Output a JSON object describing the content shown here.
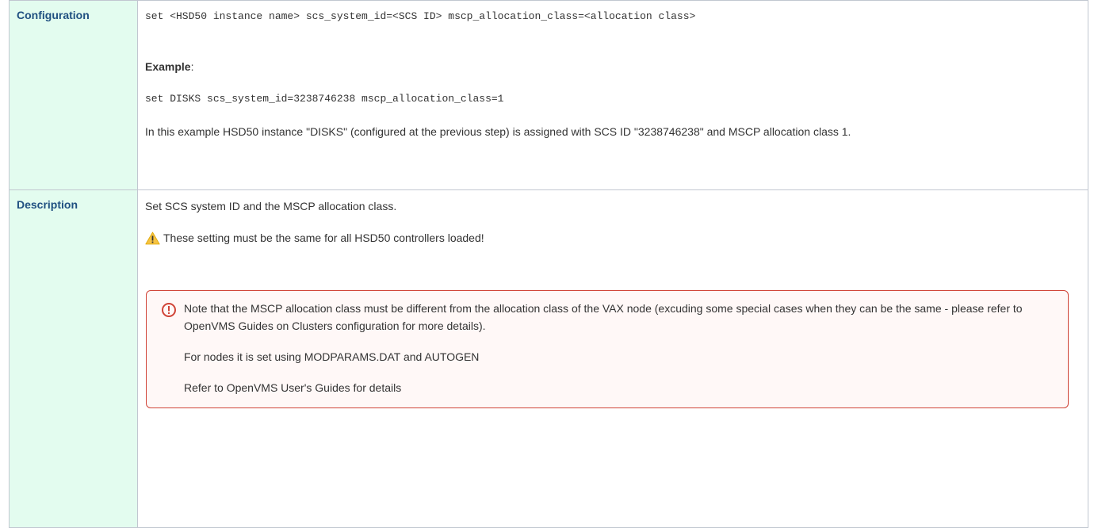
{
  "rows": {
    "configuration": {
      "label": "Configuration",
      "syntax": "set <HSD50 instance name> scs_system_id=<SCS ID> mscp_allocation_class=<allocation class>",
      "example_label": "Example",
      "example_colon": ":",
      "example_code": "set DISKS scs_system_id=3238746238 mscp_allocation_class=1",
      "example_explanation": "In this example HSD50 instance \"DISKS\" (configured at the previous step) is assigned with SCS ID \"3238746238\" and MSCP allocation class 1."
    },
    "description": {
      "label": "Description",
      "text": "Set SCS system ID and the MSCP allocation class.",
      "warning": "These setting must be the same for all HSD50 controllers loaded!",
      "warning_icon": "warning-triangle-icon",
      "note": {
        "icon": "error-circle-icon",
        "text": "Note that the MSCP allocation class must be different from the allocation class of the VAX node (excuding some special cases when they can be the same - please refer to OpenVMS Guides on Clusters configuration for more details).",
        "line2": "For nodes it is set using MODPARAMS.DAT and AUTOGEN",
        "line3": "Refer to OpenVMS User's Guides for details"
      }
    }
  },
  "colors": {
    "header_bg": "#e3fcef",
    "header_text": "#205081",
    "border": "#c1c7d0",
    "note_border": "#d04437",
    "note_bg": "#fff8f7"
  }
}
